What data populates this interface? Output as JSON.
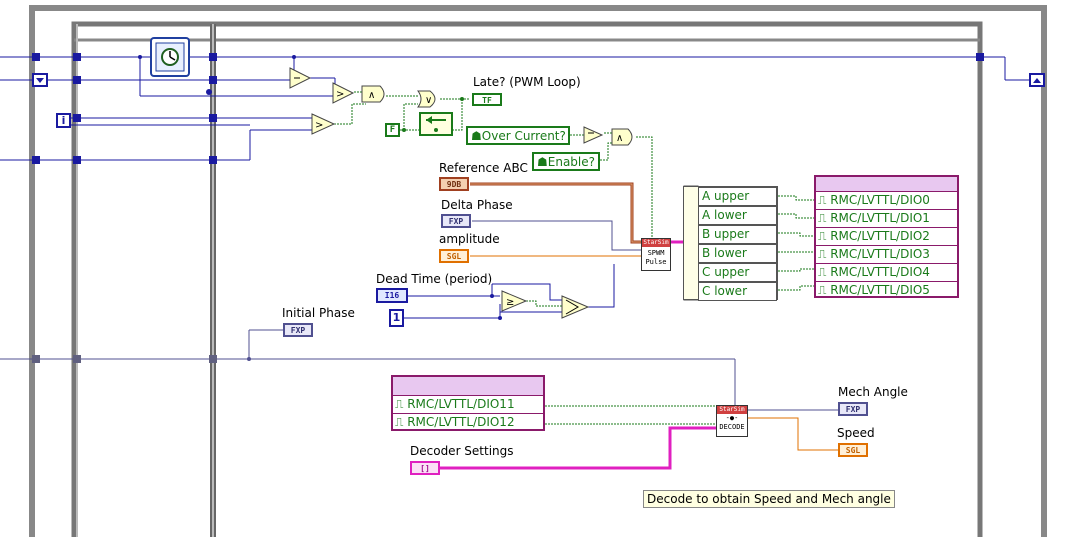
{
  "labels": {
    "late": "Late? (PWM Loop)",
    "reference_abc": "Reference ABC",
    "delta_phase": "Delta Phase",
    "amplitude": "amplitude",
    "dead_time": "Dead Time (period)",
    "initial_phase": "Initial Phase",
    "decoder_settings": "Decoder Settings",
    "mech_angle": "Mech Angle",
    "speed": "Speed"
  },
  "controls": {
    "over_current": "Over Current?",
    "enable": "Enable?",
    "false_const": "F",
    "dead_time_const": "1",
    "index": "i"
  },
  "terminals": {
    "late_type": "TF",
    "ref_type": "9DB",
    "delta_type": "FXP",
    "amp_type": "SGL",
    "dead_type": "I16",
    "initial_type": "FXP",
    "mech_type": "FXP",
    "speed_type": "SGL",
    "decoder_type": "[]"
  },
  "subvis": {
    "spwm_header": "StarSim",
    "spwm_body": "SPWM Pulse",
    "decode_header": "StarSim",
    "decode_body": "DECODE"
  },
  "pwm_cluster": [
    "A upper",
    "A lower",
    "B upper",
    "B lower",
    "C upper",
    "C lower"
  ],
  "dio_outputs": [
    "RMC/LVTTL/DIO0",
    "RMC/LVTTL/DIO1",
    "RMC/LVTTL/DIO2",
    "RMC/LVTTL/DIO3",
    "RMC/LVTTL/DIO4",
    "RMC/LVTTL/DIO5"
  ],
  "dio_inputs": [
    "RMC/LVTTL/DIO11",
    "RMC/LVTTL/DIO12"
  ],
  "comment": "Decode to obtain Speed and Mech angle",
  "colors": {
    "wire_bool": "#1a7a1a",
    "wire_int": "#1a1aa0",
    "wire_fxp": "#505090",
    "wire_sgl": "#e07000",
    "wire_cluster": "#a04020",
    "wire_decoder": "#e020c0",
    "frame": "#888888"
  }
}
